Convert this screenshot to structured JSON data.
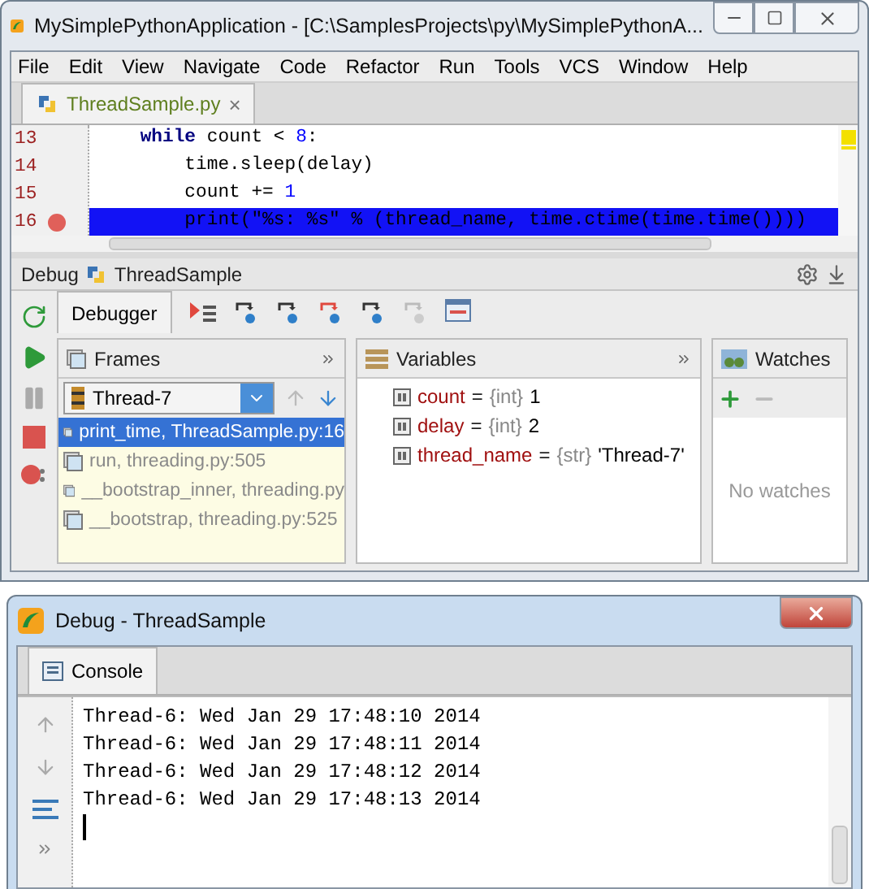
{
  "window": {
    "title": "MySimplePythonApplication - [C:\\SamplesProjects\\py\\MySimplePythonA..."
  },
  "menu": [
    "File",
    "Edit",
    "View",
    "Navigate",
    "Code",
    "Refactor",
    "Run",
    "Tools",
    "VCS",
    "Window",
    "Help"
  ],
  "editor_tabs": [
    {
      "label": "ThreadSample.py",
      "selected": true,
      "close": "×"
    }
  ],
  "editor": {
    "lines": [
      {
        "number": "13",
        "breakpoint": false,
        "selected": false,
        "tokens": [
          {
            "kind": "keyword",
            "text": "    while"
          },
          {
            "kind": "plain",
            "text": " count < "
          },
          {
            "kind": "number",
            "text": "8"
          },
          {
            "kind": "plain",
            "text": ":"
          }
        ]
      },
      {
        "number": "14",
        "breakpoint": false,
        "selected": false,
        "tokens": [
          {
            "kind": "plain",
            "text": "        time.sleep(delay)"
          }
        ]
      },
      {
        "number": "15",
        "breakpoint": false,
        "selected": false,
        "tokens": [
          {
            "kind": "plain",
            "text": "        count += "
          },
          {
            "kind": "number",
            "text": "1"
          }
        ]
      },
      {
        "number": "16",
        "breakpoint": true,
        "selected": true,
        "tokens": [
          {
            "kind": "plain",
            "text": "        print(\"%s: %s\" % (thread_name, time.ctime(time.time())))"
          }
        ]
      }
    ]
  },
  "debug": {
    "label": "Debug",
    "config": "ThreadSample",
    "tabs": [
      {
        "label": "Debugger",
        "selected": true
      }
    ],
    "frames": {
      "title": "Frames",
      "thread": "Thread-7",
      "items": [
        {
          "label": "print_time, ThreadSample.py:16",
          "selected": true
        },
        {
          "label": "run, threading.py:505",
          "selected": false
        },
        {
          "label": "__bootstrap_inner, threading.py",
          "selected": false
        },
        {
          "label": "__bootstrap, threading.py:525",
          "selected": false
        }
      ]
    },
    "variables": {
      "title": "Variables",
      "items": [
        {
          "name": "count",
          "equals": "=",
          "type": "{int}",
          "value": "1"
        },
        {
          "name": "delay",
          "equals": "=",
          "type": "{int}",
          "value": "2"
        },
        {
          "name": "thread_name",
          "equals": "=",
          "type": "{str}",
          "value": "'Thread-7'"
        }
      ]
    },
    "watches": {
      "title": "Watches",
      "empty_text": "No watches"
    }
  },
  "console_window": {
    "title": "Debug - ThreadSample",
    "tabs": [
      {
        "label": "Console",
        "selected": true
      }
    ],
    "lines": [
      "Thread-6: Wed Jan 29 17:48:10 2014",
      "Thread-6: Wed Jan 29 17:48:11 2014",
      "Thread-6: Wed Jan 29 17:48:12 2014",
      "Thread-6: Wed Jan 29 17:48:13 2014"
    ]
  }
}
